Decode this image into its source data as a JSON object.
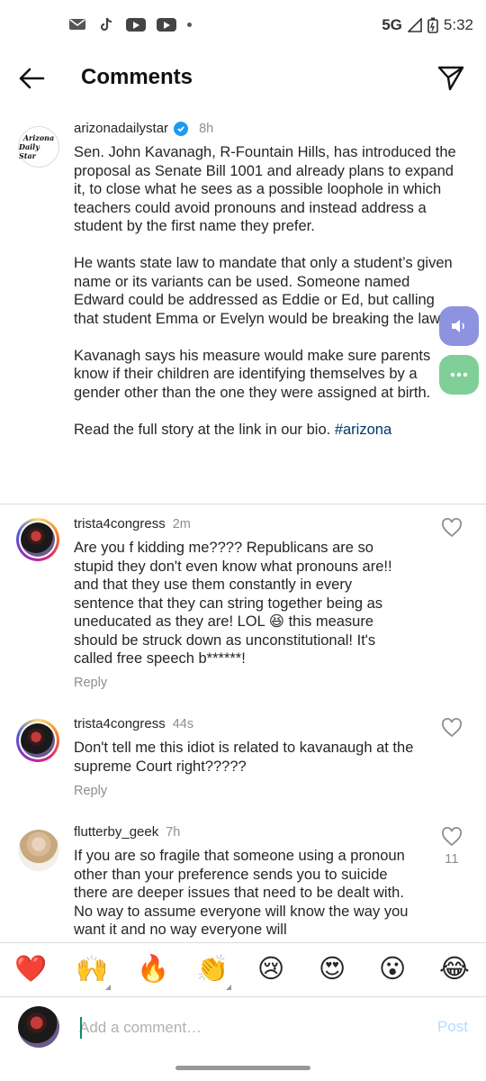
{
  "status_bar": {
    "network": "5G",
    "time": "5:32",
    "icons": [
      "mail-icon",
      "tiktok-icon",
      "youtube-icon",
      "youtube-icon",
      "dot-icon"
    ]
  },
  "header": {
    "title": "Comments",
    "back_icon": "arrow-left-icon",
    "send_icon": "paper-plane-icon"
  },
  "caption": {
    "logo_line1": "Arizona",
    "logo_line2": "Daily Star",
    "username": "arizonadailystar",
    "verified": true,
    "time": "8h",
    "text": "Sen. John Kavanagh, R-Fountain Hills, has introduced the proposal as Senate Bill 1001 and already plans to expand it, to close what he sees as a possible loophole in which teachers could avoid pronouns and instead address a student by the first name they prefer.\n\nHe wants state law to mandate that only a student’s given name or its variants can be used. Someone named Edward could be addressed as Eddie or Ed, but calling that student Emma or Evelyn would be breaking the law.\n\nKavanagh says his measure would make sure parents know if their children are identifying themselves by a gender other than the one they were assigned at birth.\n\nRead the full story at the link in our bio. ",
    "hashtag": "#arizona"
  },
  "comments": [
    {
      "username": "trista4congress",
      "time": "2m",
      "text": "Are you f kidding me???? Republicans are so stupid they don't even know what pronouns are!! and that they use them constantly in every sentence that they can string together being as uneducated as they are! LOL 😆 this measure should be struck down as unconstitutional! It's called free speech b******!",
      "reply_label": "Reply",
      "likes": ""
    },
    {
      "username": "trista4congress",
      "time": "44s",
      "text": "Don't tell me this idiot is related to kavanaugh at the supreme Court right?????",
      "reply_label": "Reply",
      "likes": ""
    },
    {
      "username": "flutterby_geek",
      "time": "7h",
      "text": "If you are so fragile that someone using a pronoun other than your preference sends you to suicide there are deeper issues that need to be dealt with. No way to assume everyone will know the way you want it and no way everyone will",
      "reply_label": "",
      "likes": "11"
    }
  ],
  "emoji_bar": [
    "❤️",
    "🙌",
    "🔥",
    "👏",
    "😢",
    "😍",
    "😮",
    "😂"
  ],
  "input": {
    "placeholder": "Add a comment…",
    "post_label": "Post"
  },
  "colors": {
    "link": "#00376b",
    "muted": "#8e8e8e",
    "verified": "#1d9bf0",
    "post_disabled": "#b3dbff"
  }
}
